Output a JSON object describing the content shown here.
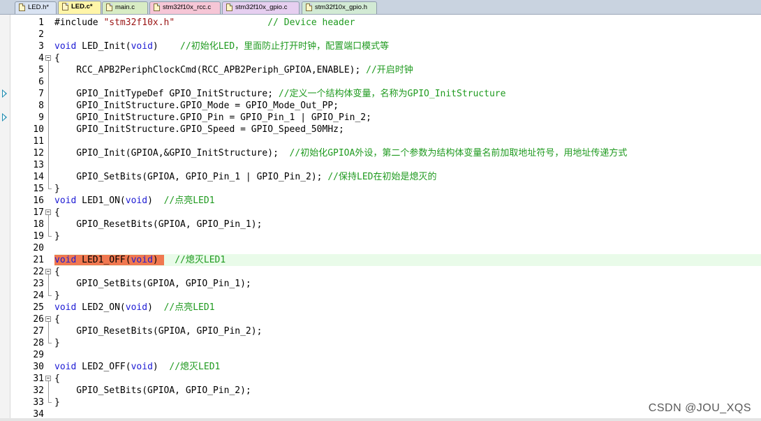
{
  "tabs": [
    {
      "label": "LED.h*",
      "active": false,
      "color": "#d9e3f2"
    },
    {
      "label": "LED.c*",
      "active": true,
      "color": "#fff5a8"
    },
    {
      "label": "main.c",
      "active": false,
      "color": "#d8ecc4"
    },
    {
      "label": "stm32f10x_rcc.c",
      "active": false,
      "color": "#f6c6d6"
    },
    {
      "label": "stm32f10x_gpio.c",
      "active": false,
      "color": "#e6cff0"
    },
    {
      "label": "stm32f10x_gpio.h",
      "active": false,
      "color": "#d2ead4"
    }
  ],
  "bookmark_lines": [
    7,
    9
  ],
  "current_line": 21,
  "fold_regions": [
    [
      4,
      15
    ],
    [
      17,
      19
    ],
    [
      22,
      24
    ],
    [
      26,
      28
    ],
    [
      31,
      33
    ]
  ],
  "lines": [
    {
      "n": "1",
      "t": [
        [
          "n",
          "#include "
        ],
        [
          "s",
          "\"stm32f10x.h\""
        ],
        [
          "n",
          "                 "
        ],
        [
          "c",
          "// Device header"
        ]
      ]
    },
    {
      "n": "2",
      "t": []
    },
    {
      "n": "3",
      "t": [
        [
          "k",
          "void"
        ],
        [
          "n",
          " LED_Init("
        ],
        [
          "k",
          "void"
        ],
        [
          "n",
          ")    "
        ],
        [
          "c",
          "//初始化LED，里面防止打开时钟，配置端口模式等"
        ]
      ]
    },
    {
      "n": "4",
      "t": [
        [
          "n",
          "{"
        ]
      ]
    },
    {
      "n": "5",
      "t": [
        [
          "n",
          "    RCC_APB2PeriphClockCmd(RCC_APB2Periph_GPIOA,ENABLE); "
        ],
        [
          "c",
          "//开启时钟"
        ]
      ]
    },
    {
      "n": "6",
      "t": []
    },
    {
      "n": "7",
      "t": [
        [
          "n",
          "    GPIO_InitTypeDef GPIO_InitStructure; "
        ],
        [
          "c",
          "//定义一个结构体变量，名称为GPIO_InitStructure"
        ]
      ]
    },
    {
      "n": "8",
      "t": [
        [
          "n",
          "    GPIO_InitStructure.GPIO_Mode = GPIO_Mode_Out_PP;"
        ]
      ]
    },
    {
      "n": "9",
      "t": [
        [
          "n",
          "    GPIO_InitStructure.GPIO_Pin = GPIO_Pin_1 | GPIO_Pin_2;"
        ]
      ]
    },
    {
      "n": "10",
      "t": [
        [
          "n",
          "    GPIO_InitStructure.GPIO_Speed = GPIO_Speed_50MHz;"
        ]
      ]
    },
    {
      "n": "11",
      "t": []
    },
    {
      "n": "12",
      "t": [
        [
          "n",
          "    GPIO_Init(GPIOA,&GPIO_InitStructure);  "
        ],
        [
          "c",
          "//初始化GPIOA外设，第二个参数为结构体变量名前加取地址符号，用地址传递方式"
        ]
      ]
    },
    {
      "n": "13",
      "t": []
    },
    {
      "n": "14",
      "t": [
        [
          "n",
          "    GPIO_SetBits(GPIOA, GPIO_Pin_1 | GPIO_Pin_2); "
        ],
        [
          "c",
          "//保持LED在初始是熄灭的"
        ]
      ]
    },
    {
      "n": "15",
      "t": [
        [
          "n",
          "}"
        ]
      ]
    },
    {
      "n": "16",
      "t": [
        [
          "k",
          "void"
        ],
        [
          "n",
          " LED1_ON("
        ],
        [
          "k",
          "void"
        ],
        [
          "n",
          ")  "
        ],
        [
          "c",
          "//点亮LED1"
        ]
      ]
    },
    {
      "n": "17",
      "t": [
        [
          "n",
          "{"
        ]
      ]
    },
    {
      "n": "18",
      "t": [
        [
          "n",
          "    GPIO_ResetBits(GPIOA, GPIO_Pin_1);"
        ]
      ]
    },
    {
      "n": "19",
      "t": [
        [
          "n",
          "}"
        ]
      ]
    },
    {
      "n": "20",
      "t": []
    },
    {
      "n": "21",
      "t": [
        [
          "hk",
          "void"
        ],
        [
          "h",
          " LED1_OFF("
        ],
        [
          "hk",
          "void"
        ],
        [
          "h",
          ") "
        ],
        [
          "n",
          "  "
        ],
        [
          "c",
          "//熄灭LED1"
        ]
      ]
    },
    {
      "n": "22",
      "t": [
        [
          "n",
          "{"
        ]
      ]
    },
    {
      "n": "23",
      "t": [
        [
          "n",
          "    GPIO_SetBits(GPIOA, GPIO_Pin_1);"
        ]
      ]
    },
    {
      "n": "24",
      "t": [
        [
          "n",
          "}"
        ]
      ]
    },
    {
      "n": "25",
      "t": [
        [
          "k",
          "void"
        ],
        [
          "n",
          " LED2_ON("
        ],
        [
          "k",
          "void"
        ],
        [
          "n",
          ")  "
        ],
        [
          "c",
          "//点亮LED1"
        ]
      ]
    },
    {
      "n": "26",
      "t": [
        [
          "n",
          "{"
        ]
      ]
    },
    {
      "n": "27",
      "t": [
        [
          "n",
          "    GPIO_ResetBits(GPIOA, GPIO_Pin_2);"
        ]
      ]
    },
    {
      "n": "28",
      "t": [
        [
          "n",
          "}"
        ]
      ]
    },
    {
      "n": "29",
      "t": []
    },
    {
      "n": "30",
      "t": [
        [
          "k",
          "void"
        ],
        [
          "n",
          " LED2_OFF("
        ],
        [
          "k",
          "void"
        ],
        [
          "n",
          ")  "
        ],
        [
          "c",
          "//熄灭LED1"
        ]
      ]
    },
    {
      "n": "31",
      "t": [
        [
          "n",
          "{"
        ]
      ]
    },
    {
      "n": "32",
      "t": [
        [
          "n",
          "    GPIO_SetBits(GPIOA, GPIO_Pin_2);"
        ]
      ]
    },
    {
      "n": "33",
      "t": [
        [
          "n",
          "}"
        ]
      ]
    },
    {
      "n": "34",
      "t": []
    }
  ],
  "watermark": "CSDN @JOU_XQS"
}
